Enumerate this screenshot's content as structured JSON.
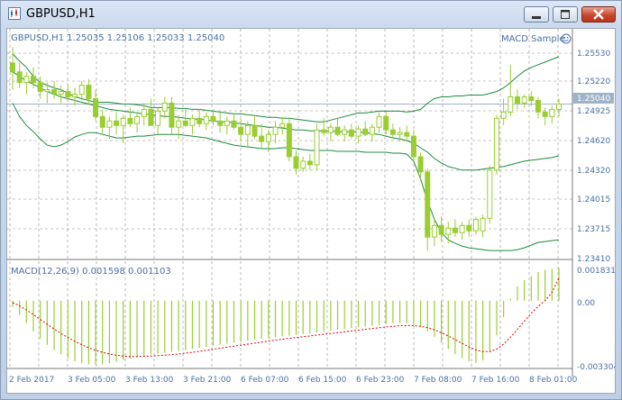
{
  "window": {
    "title": "GBPUSD,H1",
    "controls": [
      "minimize-icon",
      "maximize-icon",
      "close-icon"
    ]
  },
  "main_chart": {
    "header": "GBPUSD,H1  1.25035 1.25106 1.25033 1.25040",
    "expert_label": "MACD Sample",
    "current_price": "1.25040",
    "price_axis": [
      "1.25530",
      "1.25220",
      "1.24925",
      "1.24620",
      "1.24320",
      "1.24015",
      "1.23715",
      "1.23410"
    ],
    "colors": {
      "candle": "#9acd32",
      "bands": "#1e8b3e",
      "grid": "#8a8a8a",
      "price_line": "#9fb3c8",
      "axis_text": "#4a6fa5"
    }
  },
  "macd": {
    "header": "MACD(12,26,9) 0.001598 0.001103",
    "axis": [
      "0.001831",
      "0.00",
      "-0.003304"
    ],
    "colors": {
      "histogram": "#9acd32",
      "signal": "#e00000"
    }
  },
  "time_axis": [
    "2 Feb 2017",
    "3 Feb 05:00",
    "3 Feb 13:00",
    "3 Feb 21:00",
    "6 Feb 07:00",
    "6 Feb 15:00",
    "6 Feb 23:00",
    "7 Feb 08:00",
    "7 Feb 16:00",
    "8 Feb 01:00"
  ],
  "chart_data": [
    {
      "type": "candlestick",
      "title": "GBPUSD,H1",
      "price_range": [
        1.2334,
        1.2568
      ],
      "grid": true,
      "current_price": 1.2504,
      "candles": [
        {
          "o": 1.255,
          "h": 1.2568,
          "l": 1.252,
          "c": 1.254
        },
        {
          "o": 1.254,
          "h": 1.255,
          "l": 1.2522,
          "c": 1.2528
        },
        {
          "o": 1.2528,
          "h": 1.254,
          "l": 1.2515,
          "c": 1.2535
        },
        {
          "o": 1.2535,
          "h": 1.2545,
          "l": 1.2522,
          "c": 1.2528
        },
        {
          "o": 1.2528,
          "h": 1.2535,
          "l": 1.251,
          "c": 1.2518
        },
        {
          "o": 1.2518,
          "h": 1.2528,
          "l": 1.2505,
          "c": 1.252
        },
        {
          "o": 1.252,
          "h": 1.253,
          "l": 1.251,
          "c": 1.2515
        },
        {
          "o": 1.2515,
          "h": 1.2525,
          "l": 1.2505,
          "c": 1.2518
        },
        {
          "o": 1.2518,
          "h": 1.2526,
          "l": 1.2508,
          "c": 1.2512
        },
        {
          "o": 1.2512,
          "h": 1.2522,
          "l": 1.2502,
          "c": 1.2515
        },
        {
          "o": 1.2515,
          "h": 1.253,
          "l": 1.2508,
          "c": 1.2525
        },
        {
          "o": 1.2525,
          "h": 1.2532,
          "l": 1.2505,
          "c": 1.251
        },
        {
          "o": 1.251,
          "h": 1.252,
          "l": 1.2485,
          "c": 1.249
        },
        {
          "o": 1.249,
          "h": 1.2498,
          "l": 1.247,
          "c": 1.2478
        },
        {
          "o": 1.2478,
          "h": 1.249,
          "l": 1.2465,
          "c": 1.2485
        },
        {
          "o": 1.2485,
          "h": 1.2495,
          "l": 1.247,
          "c": 1.248
        },
        {
          "o": 1.248,
          "h": 1.2492,
          "l": 1.246,
          "c": 1.2488
        },
        {
          "o": 1.2488,
          "h": 1.25,
          "l": 1.2478,
          "c": 1.2482
        },
        {
          "o": 1.2482,
          "h": 1.2495,
          "l": 1.2472,
          "c": 1.249
        },
        {
          "o": 1.249,
          "h": 1.2505,
          "l": 1.248,
          "c": 1.2498
        },
        {
          "o": 1.2498,
          "h": 1.251,
          "l": 1.2485,
          "c": 1.248
        },
        {
          "o": 1.248,
          "h": 1.25,
          "l": 1.247,
          "c": 1.2496
        },
        {
          "o": 1.2496,
          "h": 1.2512,
          "l": 1.2488,
          "c": 1.2505
        },
        {
          "o": 1.2505,
          "h": 1.2512,
          "l": 1.247,
          "c": 1.2478
        },
        {
          "o": 1.2478,
          "h": 1.2492,
          "l": 1.2465,
          "c": 1.2485
        },
        {
          "o": 1.2485,
          "h": 1.2498,
          "l": 1.2478,
          "c": 1.248
        },
        {
          "o": 1.248,
          "h": 1.2492,
          "l": 1.247,
          "c": 1.2488
        },
        {
          "o": 1.2488,
          "h": 1.2498,
          "l": 1.2478,
          "c": 1.2482
        },
        {
          "o": 1.2482,
          "h": 1.2495,
          "l": 1.2475,
          "c": 1.249
        },
        {
          "o": 1.249,
          "h": 1.2498,
          "l": 1.248,
          "c": 1.2485
        },
        {
          "o": 1.2485,
          "h": 1.2495,
          "l": 1.2472,
          "c": 1.248
        },
        {
          "o": 1.248,
          "h": 1.249,
          "l": 1.247,
          "c": 1.2485
        },
        {
          "o": 1.2485,
          "h": 1.2492,
          "l": 1.2475,
          "c": 1.2478
        },
        {
          "o": 1.2478,
          "h": 1.2488,
          "l": 1.2462,
          "c": 1.247
        },
        {
          "o": 1.247,
          "h": 1.2485,
          "l": 1.2455,
          "c": 1.248
        },
        {
          "o": 1.248,
          "h": 1.249,
          "l": 1.2465,
          "c": 1.2468
        },
        {
          "o": 1.2468,
          "h": 1.2482,
          "l": 1.2455,
          "c": 1.2462
        },
        {
          "o": 1.2462,
          "h": 1.2475,
          "l": 1.245,
          "c": 1.247
        },
        {
          "o": 1.247,
          "h": 1.2485,
          "l": 1.246,
          "c": 1.2478
        },
        {
          "o": 1.2478,
          "h": 1.249,
          "l": 1.247,
          "c": 1.2482
        },
        {
          "o": 1.2482,
          "h": 1.2488,
          "l": 1.244,
          "c": 1.2445
        },
        {
          "o": 1.2445,
          "h": 1.2452,
          "l": 1.2425,
          "c": 1.2432
        },
        {
          "o": 1.2432,
          "h": 1.2445,
          "l": 1.2428,
          "c": 1.244
        },
        {
          "o": 1.244,
          "h": 1.2448,
          "l": 1.243,
          "c": 1.2436
        },
        {
          "o": 1.2436,
          "h": 1.2482,
          "l": 1.243,
          "c": 1.2475
        },
        {
          "o": 1.2475,
          "h": 1.2488,
          "l": 1.2468,
          "c": 1.2472
        },
        {
          "o": 1.2472,
          "h": 1.2482,
          "l": 1.2462,
          "c": 1.2478
        },
        {
          "o": 1.2478,
          "h": 1.2488,
          "l": 1.2468,
          "c": 1.247
        },
        {
          "o": 1.247,
          "h": 1.248,
          "l": 1.2462,
          "c": 1.2475
        },
        {
          "o": 1.2475,
          "h": 1.2482,
          "l": 1.2465,
          "c": 1.2468
        },
        {
          "o": 1.2468,
          "h": 1.248,
          "l": 1.246,
          "c": 1.2476
        },
        {
          "o": 1.2476,
          "h": 1.2485,
          "l": 1.2468,
          "c": 1.247
        },
        {
          "o": 1.247,
          "h": 1.2482,
          "l": 1.2462,
          "c": 1.2478
        },
        {
          "o": 1.2478,
          "h": 1.2495,
          "l": 1.2472,
          "c": 1.249
        },
        {
          "o": 1.249,
          "h": 1.2495,
          "l": 1.247,
          "c": 1.2475
        },
        {
          "o": 1.2475,
          "h": 1.2482,
          "l": 1.2465,
          "c": 1.247
        },
        {
          "o": 1.247,
          "h": 1.2478,
          "l": 1.2462,
          "c": 1.2472
        },
        {
          "o": 1.2472,
          "h": 1.248,
          "l": 1.2462,
          "c": 1.2468
        },
        {
          "o": 1.2468,
          "h": 1.2475,
          "l": 1.244,
          "c": 1.2445
        },
        {
          "o": 1.2445,
          "h": 1.245,
          "l": 1.242,
          "c": 1.2428
        },
        {
          "o": 1.2428,
          "h": 1.2432,
          "l": 1.234,
          "c": 1.2355
        },
        {
          "o": 1.2355,
          "h": 1.2375,
          "l": 1.2345,
          "c": 1.2368
        },
        {
          "o": 1.2368,
          "h": 1.2378,
          "l": 1.235,
          "c": 1.2358
        },
        {
          "o": 1.2358,
          "h": 1.2372,
          "l": 1.2348,
          "c": 1.2365
        },
        {
          "o": 1.2365,
          "h": 1.2375,
          "l": 1.2355,
          "c": 1.236
        },
        {
          "o": 1.236,
          "h": 1.2372,
          "l": 1.2352,
          "c": 1.2368
        },
        {
          "o": 1.2368,
          "h": 1.2375,
          "l": 1.2355,
          "c": 1.2362
        },
        {
          "o": 1.2362,
          "h": 1.2378,
          "l": 1.2358,
          "c": 1.2375
        },
        {
          "o": 1.2362,
          "h": 1.238,
          "l": 1.2355,
          "c": 1.2376
        },
        {
          "o": 1.2376,
          "h": 1.2435,
          "l": 1.237,
          "c": 1.243
        },
        {
          "o": 1.243,
          "h": 1.2492,
          "l": 1.2425,
          "c": 1.2488
        },
        {
          "o": 1.2488,
          "h": 1.251,
          "l": 1.248,
          "c": 1.2495
        },
        {
          "o": 1.2495,
          "h": 1.2548,
          "l": 1.249,
          "c": 1.2512
        },
        {
          "o": 1.2512,
          "h": 1.252,
          "l": 1.2498,
          "c": 1.2505
        },
        {
          "o": 1.2505,
          "h": 1.2515,
          "l": 1.25,
          "c": 1.2512
        },
        {
          "o": 1.2512,
          "h": 1.2518,
          "l": 1.2502,
          "c": 1.2508
        },
        {
          "o": 1.2508,
          "h": 1.2512,
          "l": 1.2488,
          "c": 1.2495
        },
        {
          "o": 1.2495,
          "h": 1.25,
          "l": 1.248,
          "c": 1.249
        },
        {
          "o": 1.249,
          "h": 1.2502,
          "l": 1.2482,
          "c": 1.2498
        },
        {
          "o": 1.2498,
          "h": 1.251,
          "l": 1.249,
          "c": 1.2504
        }
      ],
      "bands": {
        "upper": [
          1.256,
          1.2552,
          1.2545,
          1.2535,
          1.2528,
          1.2525,
          1.2522,
          1.252,
          1.2516,
          1.2512,
          1.251,
          1.2508,
          1.2506,
          1.2506,
          1.2506,
          1.2505,
          1.2504,
          1.2504,
          1.2503,
          1.2502,
          1.25,
          1.25,
          1.25,
          1.25,
          1.2499,
          1.2499,
          1.2498,
          1.2498,
          1.2497,
          1.2496,
          1.2495,
          1.2494,
          1.2493,
          1.2493,
          1.2492,
          1.2491,
          1.249,
          1.2489,
          1.2489,
          1.2488,
          1.2488,
          1.2487,
          1.2486,
          1.2485,
          1.2484,
          1.2484,
          1.2486,
          1.2488,
          1.249,
          1.2492,
          1.2494,
          1.2494,
          1.2495,
          1.2496,
          1.2496,
          1.2496,
          1.2496,
          1.2495,
          1.2496,
          1.2498,
          1.2505,
          1.251,
          1.2512,
          1.2512,
          1.2513,
          1.2513,
          1.2514,
          1.2514,
          1.2514,
          1.2516,
          1.2518,
          1.2522,
          1.2528,
          1.2535,
          1.2541,
          1.2545,
          1.2548,
          1.2551,
          1.2554,
          1.2557
        ],
        "middle": [
          1.254,
          1.2535,
          1.253,
          1.2526,
          1.2522,
          1.2518,
          1.2515,
          1.2512,
          1.251,
          1.2508,
          1.2506,
          1.2504,
          1.2502,
          1.25,
          1.2498,
          1.2497,
          1.2496,
          1.2495,
          1.2494,
          1.2493,
          1.2492,
          1.2491,
          1.249,
          1.249,
          1.2489,
          1.2488,
          1.2487,
          1.2487,
          1.2486,
          1.2485,
          1.2484,
          1.2484,
          1.2483,
          1.2482,
          1.2481,
          1.248,
          1.2479,
          1.2478,
          1.2478,
          1.2477,
          1.2476,
          1.2475,
          1.2475,
          1.2474,
          1.2474,
          1.2474,
          1.2474,
          1.2473,
          1.2473,
          1.2473,
          1.2473,
          1.2472,
          1.2471,
          1.247,
          1.2468,
          1.2466,
          1.2465,
          1.2463,
          1.246,
          1.2455,
          1.245,
          1.2443,
          1.2438,
          1.2434,
          1.2432,
          1.243,
          1.243,
          1.243,
          1.2431,
          1.2432,
          1.2433,
          1.2434,
          1.2436,
          1.2438,
          1.244,
          1.2441,
          1.2442,
          1.2443,
          1.2444,
          1.2446
        ],
        "lower": [
          1.2505,
          1.249,
          1.248,
          1.2473,
          1.2465,
          1.2458,
          1.2456,
          1.2458,
          1.2462,
          1.2467,
          1.247,
          1.2472,
          1.2472,
          1.247,
          1.2468,
          1.2466,
          1.2466,
          1.2467,
          1.2468,
          1.2468,
          1.2469,
          1.247,
          1.247,
          1.247,
          1.247,
          1.2469,
          1.2468,
          1.2467,
          1.2466,
          1.2464,
          1.2462,
          1.246,
          1.2458,
          1.2457,
          1.2456,
          1.2455,
          1.2454,
          1.2454,
          1.2454,
          1.2455,
          1.2455,
          1.2454,
          1.2453,
          1.2452,
          1.2452,
          1.2452,
          1.2452,
          1.2451,
          1.2451,
          1.2451,
          1.2451,
          1.245,
          1.245,
          1.245,
          1.245,
          1.2449,
          1.2449,
          1.2448,
          1.244,
          1.242,
          1.2395,
          1.2375,
          1.236,
          1.2352,
          1.2348,
          1.2345,
          1.2343,
          1.2342,
          1.2341,
          1.234,
          1.234,
          1.234,
          1.234,
          1.2341,
          1.2343,
          1.2346,
          1.2349,
          1.235,
          1.2351,
          1.2352
        ]
      }
    },
    {
      "type": "bar",
      "title": "MACD(12,26,9)",
      "range": [
        -0.003304,
        0.001831
      ],
      "histogram": [
        -0.0003,
        -0.0007,
        -0.0011,
        -0.0015,
        -0.00185,
        -0.00215,
        -0.0024,
        -0.00262,
        -0.0028,
        -0.00295,
        -0.00305,
        -0.0031,
        -0.00312,
        -0.0031,
        -0.00305,
        -0.00298,
        -0.0029,
        -0.00282,
        -0.00275,
        -0.00268,
        -0.00262,
        -0.00258,
        -0.00255,
        -0.0025,
        -0.00245,
        -0.0024,
        -0.00235,
        -0.0023,
        -0.00225,
        -0.0022,
        -0.00215,
        -0.0021,
        -0.00205,
        -0.002,
        -0.00195,
        -0.0019,
        -0.00186,
        -0.00182,
        -0.00178,
        -0.00174,
        -0.0017,
        -0.00166,
        -0.00162,
        -0.00158,
        -0.00154,
        -0.0015,
        -0.00146,
        -0.00142,
        -0.00138,
        -0.00134,
        -0.0013,
        -0.00126,
        -0.00122,
        -0.00118,
        -0.00114,
        -0.0011,
        -0.00108,
        -0.0011,
        -0.00118,
        -0.0013,
        -0.0015,
        -0.00175,
        -0.00205,
        -0.00235,
        -0.0026,
        -0.0028,
        -0.00295,
        -0.00303,
        -0.0029,
        -0.0025,
        -0.0017,
        -0.0008,
        0.0001,
        0.0007,
        0.001,
        0.0012,
        0.0014,
        0.0015,
        0.00155,
        0.0016
      ],
      "signal": [
        -0.0001,
        -0.00025,
        -0.00045,
        -0.00068,
        -0.00092,
        -0.00115,
        -0.00138,
        -0.0016,
        -0.0018,
        -0.00198,
        -0.00215,
        -0.0023,
        -0.00242,
        -0.00252,
        -0.0026,
        -0.00266,
        -0.0027,
        -0.00272,
        -0.00272,
        -0.00271,
        -0.0027,
        -0.00268,
        -0.00266,
        -0.00263,
        -0.0026,
        -0.00256,
        -0.00252,
        -0.00247,
        -0.00242,
        -0.00237,
        -0.00232,
        -0.00227,
        -0.00222,
        -0.00217,
        -0.00212,
        -0.00207,
        -0.00202,
        -0.00197,
        -0.00192,
        -0.00188,
        -0.00184,
        -0.0018,
        -0.00176,
        -0.00172,
        -0.00168,
        -0.00164,
        -0.0016,
        -0.00156,
        -0.00152,
        -0.00148,
        -0.00144,
        -0.0014,
        -0.00136,
        -0.00132,
        -0.00128,
        -0.00125,
        -0.00122,
        -0.00121,
        -0.00122,
        -0.00125,
        -0.00132,
        -0.00142,
        -0.00156,
        -0.00172,
        -0.0019,
        -0.00208,
        -0.00225,
        -0.0024,
        -0.00248,
        -0.00248,
        -0.00236,
        -0.00212,
        -0.00178,
        -0.0014,
        -0.001,
        -0.00062,
        -0.00028,
        0.0,
        0.0004,
        0.0011
      ]
    }
  ]
}
